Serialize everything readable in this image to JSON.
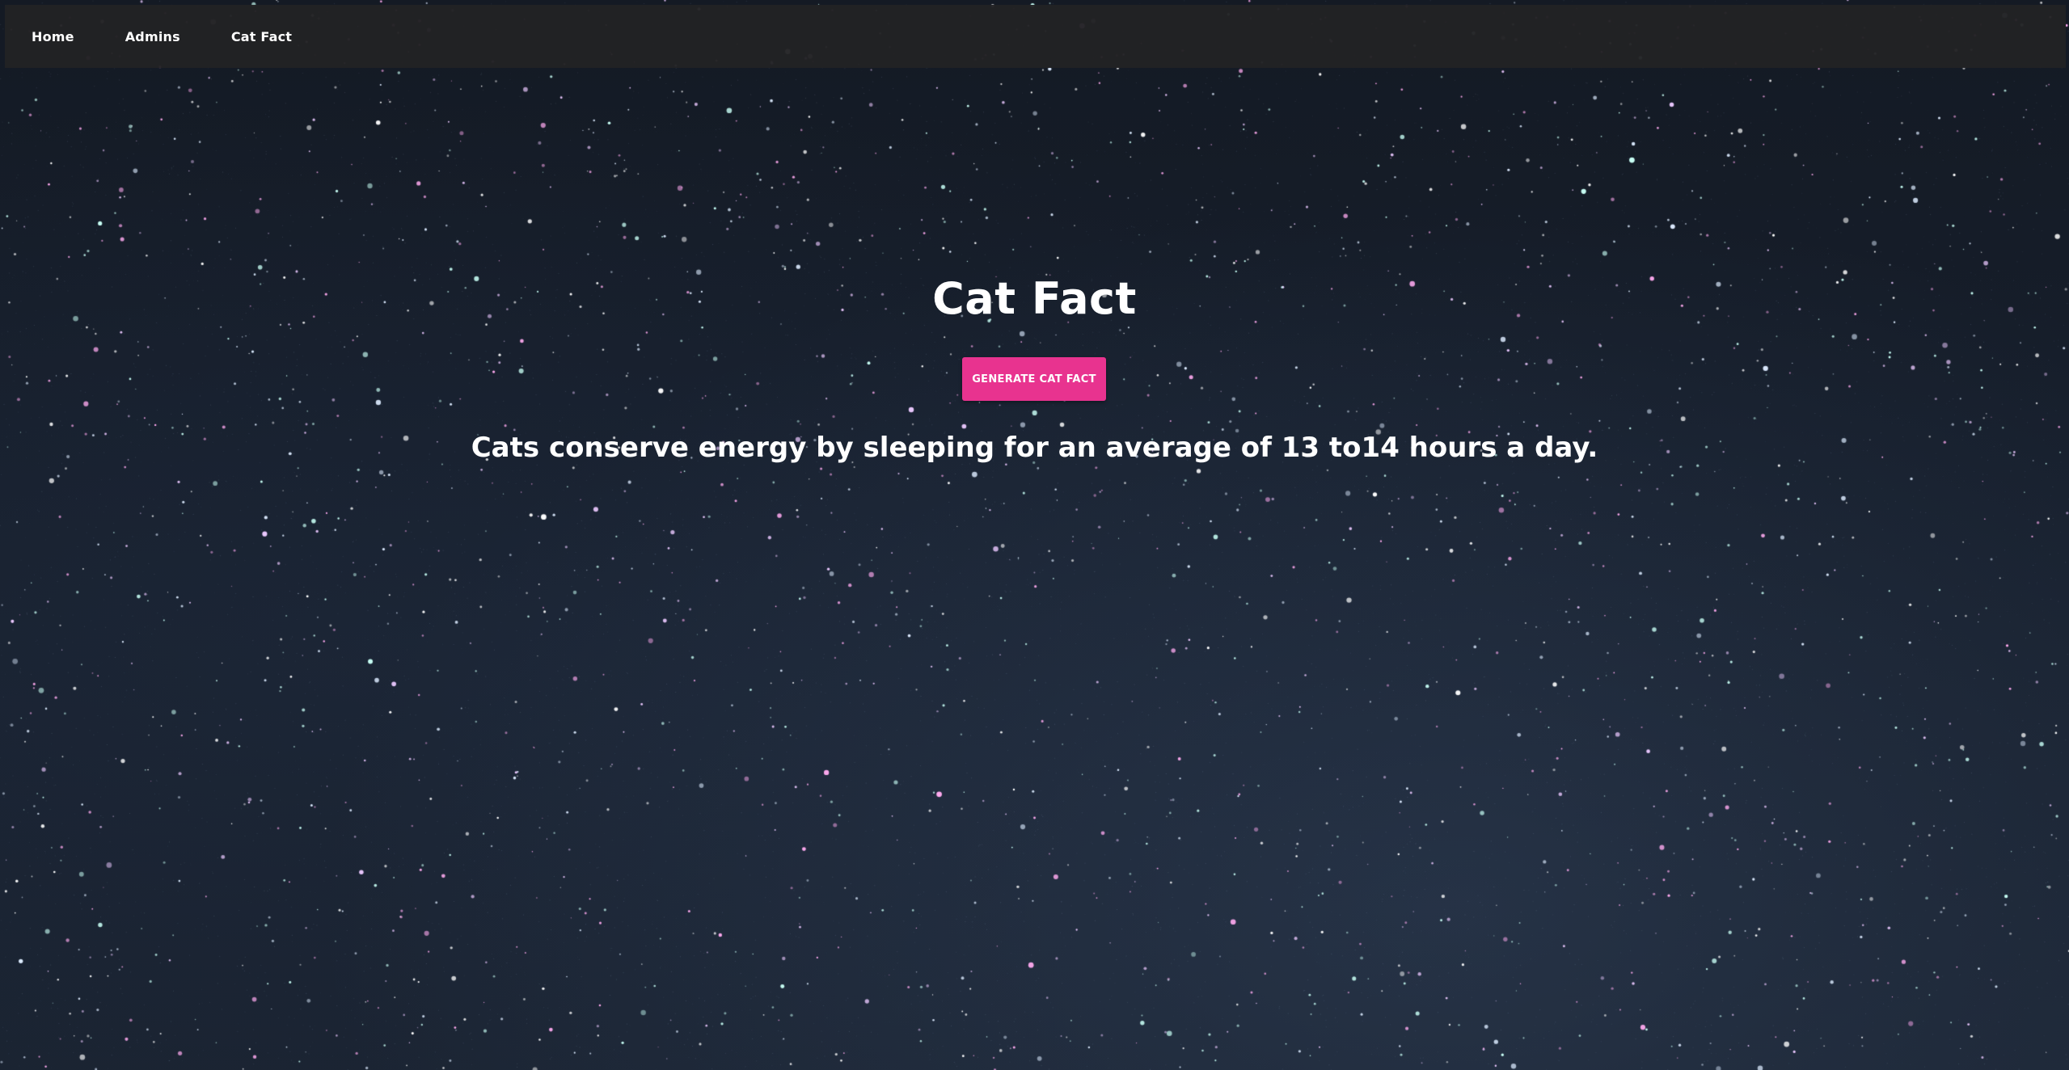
{
  "nav": {
    "items": [
      {
        "label": "Home"
      },
      {
        "label": "Admins"
      },
      {
        "label": "Cat Fact"
      }
    ]
  },
  "main": {
    "title": "Cat Fact",
    "generate_button_label": "GENERATE CAT FACT",
    "fact": "Cats conserve energy by sleeping for an average of 13 to14 hours a day."
  },
  "colors": {
    "accent": "#e8338f",
    "navbar_bg": "#222224",
    "sky": "#161e2b",
    "text": "#ffffff"
  }
}
